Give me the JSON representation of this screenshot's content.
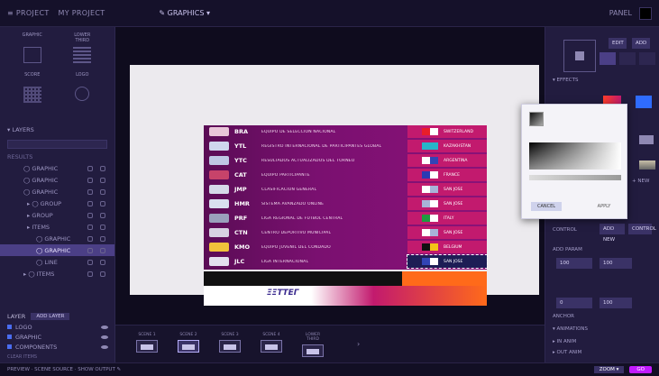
{
  "topbar": {
    "crumb1": "≡ PROJECT",
    "crumb2": "MY PROJECT",
    "workspace": "✎ GRAPHICS ▾",
    "right_label": "PANEL"
  },
  "left": {
    "templates": [
      {
        "label": "GRAPHIC",
        "kind": "box"
      },
      {
        "label": "LOWER THIRD",
        "kind": "lines"
      },
      {
        "label": "SCORE",
        "kind": "grid"
      },
      {
        "label": "LOGO",
        "kind": "circle"
      }
    ],
    "section_title": "▾ LAYERS",
    "subtitle": "RESULTS",
    "layers": [
      {
        "name": "◯ GRAPHIC",
        "indent": "ind1",
        "active": false
      },
      {
        "name": "◯ GRAPHIC",
        "indent": "ind1",
        "active": false
      },
      {
        "name": "◯ GRAPHIC",
        "indent": "ind1",
        "active": false
      },
      {
        "name": "▸ ◯ GROUP",
        "indent": "",
        "active": false
      },
      {
        "name": "▸ GROUP",
        "indent": "",
        "active": false
      },
      {
        "name": "▸ ITEMS",
        "indent": "",
        "active": false
      },
      {
        "name": "◯ GRAPHIC",
        "indent": "ind2",
        "active": false
      },
      {
        "name": "◯ GRAPHIC",
        "indent": "ind2",
        "active": true
      },
      {
        "name": "◯ LINE",
        "indent": "ind2",
        "active": false
      },
      {
        "name": "▸ ◯ ITEMS",
        "indent": "ind1",
        "active": false
      }
    ],
    "bottom_label": "LAYER",
    "bottom_button": "ADD LAYER",
    "vis_rows": [
      "LOGO",
      "GRAPHIC",
      "COMPONENTS"
    ],
    "footer": "CLEAR ITEMS"
  },
  "rows": [
    {
      "code": "BRA",
      "name": "EQUIPO DE SELECCIÓN NACIONAL",
      "flag_left": "#e8c6d8",
      "flag_colors": [
        "#e81e2a",
        "#ffffff"
      ],
      "right_name": "SWITZERLAND"
    },
    {
      "code": "YTL",
      "name": "REGISTRO INTERNACIONAL DE PARTICIPANTES GLOBAL",
      "flag_left": "#cfd6ee",
      "flag_colors": [
        "#27b5c9",
        "#27b5c9"
      ],
      "right_name": "KAZAKHSTAN"
    },
    {
      "code": "YTC",
      "name": "RESULTADOS ACTUALIZADOS DEL TORNEO",
      "flag_left": "#bfc7e5",
      "flag_colors": [
        "#ffffff",
        "#3244b5"
      ],
      "right_name": "ARGENTINA"
    },
    {
      "code": "CAT",
      "name": "EQUIPO PARTICIPANTE",
      "flag_left": "#c7436a",
      "flag_colors": [
        "#2b3ab4",
        "#ffffff"
      ],
      "right_name": "FRANCE"
    },
    {
      "code": "JMP",
      "name": "CLASIFICACIÓN GENERAL",
      "flag_left": "#d5d9e8",
      "flag_colors": [
        "#ffffff",
        "#a8b3d8"
      ],
      "right_name": "SAN JOSE"
    },
    {
      "code": "HMR",
      "name": "SISTEMA AVANZADO ONLINE",
      "flag_left": "#d9dfef",
      "flag_colors": [
        "#a8b3d8",
        "#ffffff"
      ],
      "right_name": "SAN JOSE"
    },
    {
      "code": "PRF",
      "name": "LIGA REGIONAL DE FUTBOL CENTRAL",
      "flag_left": "#9aa0bc",
      "flag_colors": [
        "#1d9a3f",
        "#ffffff"
      ],
      "right_name": "ITALY"
    },
    {
      "code": "CTN",
      "name": "CENTRO DEPORTIVO MUNICIPAL",
      "flag_left": "#d7d1e2",
      "flag_colors": [
        "#ffffff",
        "#a8b3d8"
      ],
      "right_name": "SAN JOSE"
    },
    {
      "code": "KMO",
      "name": "EQUIPO JUVENIL DEL CONDADO",
      "flag_left": "#f0c23b",
      "flag_colors": [
        "#111111",
        "#f3c318"
      ],
      "right_name": "BELGIUM"
    },
    {
      "code": "JLC",
      "name": "LIGA INTERNACIONAL",
      "flag_left": "#e3e0ee",
      "flag_colors": [
        "#3244b5",
        "#ffffff"
      ],
      "right_name": "SAN JOSE"
    }
  ],
  "logo_text": "ΞΞΤΤΕΓ",
  "picker": {
    "apply": "CANCEL",
    "cancel": "APPLY"
  },
  "rightp": {
    "btn1": "EDIT",
    "btn2": "ADD",
    "section1": "▾ EFFECTS",
    "section2": "CONTROL",
    "field1": "ADD NEW",
    "field2": "CONTROL",
    "section3": "ADD PARAM",
    "f_a": "100",
    "f_b": "100",
    "f_c": "0",
    "f_d": "100",
    "section4": "ANCHOR",
    "section5": "▾ ANIMATIONS",
    "anim1": "▸ IN ANIM",
    "anim2": "▸ OUT ANIM",
    "link": "+ NEW"
  },
  "filmstrip": [
    {
      "label": "SCENE 1",
      "active": false
    },
    {
      "label": "SCENE 2",
      "active": true
    },
    {
      "label": "SCENE 3",
      "active": false
    },
    {
      "label": "SCENE 4",
      "active": false
    },
    {
      "label": "LOWER THIRD",
      "active": false
    }
  ],
  "statusbar": {
    "left": "PREVIEW · SCENE SOURCE · SHOW OUTPUT ✎",
    "zoom": "ZOOM ▾",
    "go": "GO"
  },
  "colors": {
    "accent": "#c21aff",
    "selected": "#4b3f86",
    "graphic_pink": "#c21a6e",
    "graphic_purple": "#7a1070",
    "graphic_orange": "#ff6a1a"
  }
}
